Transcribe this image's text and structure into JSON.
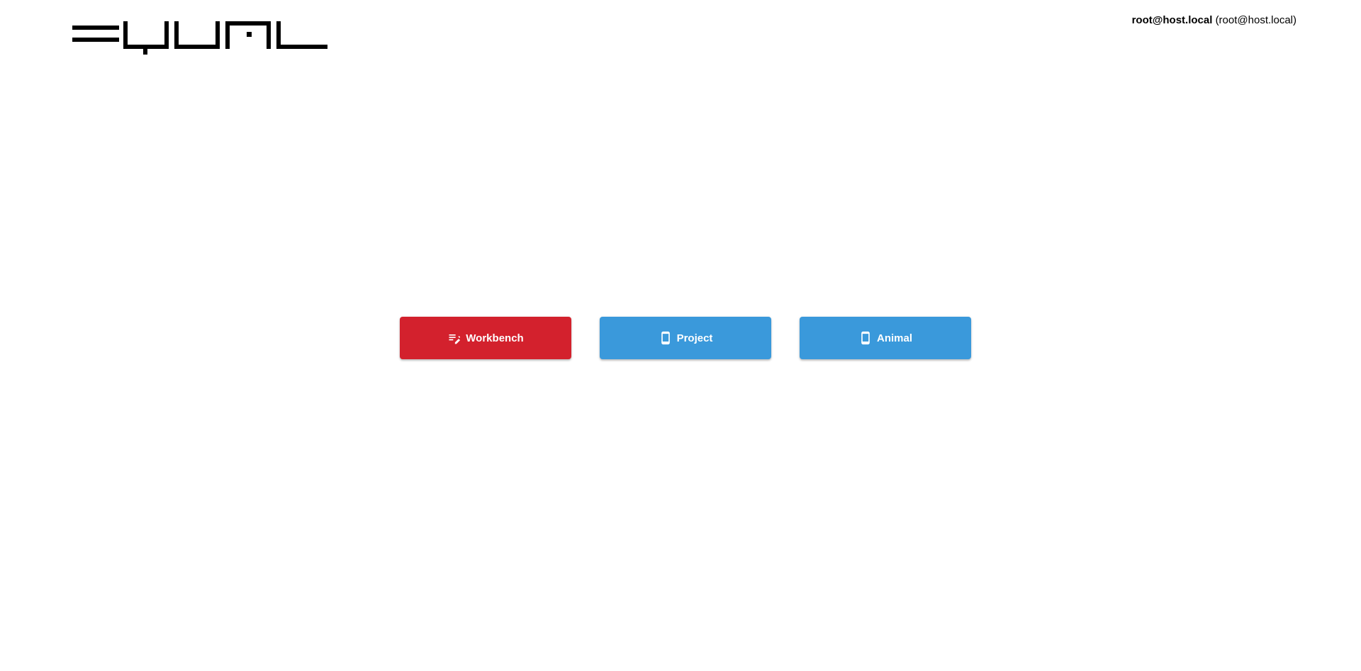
{
  "header": {
    "logo_text": "EQUAL",
    "user": {
      "name": "root@host.local",
      "email_paren": "(root@host.local)"
    }
  },
  "apps": [
    {
      "label": "Workbench",
      "icon": "edit-note-icon",
      "color": "#d3212d"
    },
    {
      "label": "Project",
      "icon": "phone-icon",
      "color": "#3a99db"
    },
    {
      "label": "Animal",
      "icon": "phone-icon",
      "color": "#3a99db"
    }
  ],
  "colors": {
    "background": "#ffffff",
    "text": "#000000",
    "workbench": "#d3212d",
    "app_blue": "#3a99db"
  }
}
